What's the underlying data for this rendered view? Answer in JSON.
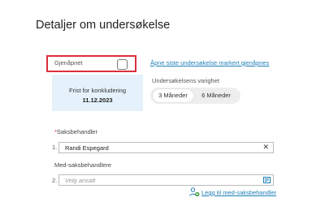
{
  "page": {
    "title": "Detaljer om undersøkelse"
  },
  "reopen": {
    "label": "Gjenåpnet",
    "checked": false,
    "link_text": "Åpne siste undersøkelse markert gjenåpnes"
  },
  "deadline": {
    "label": "Frist for konkludering",
    "date": "11.12.2023"
  },
  "duration": {
    "label": "Undersøkelsens varighet",
    "options": [
      "3 Måneder",
      "6 Måneder"
    ],
    "selected": "3 Måneder"
  },
  "caseworker": {
    "required_mark": "*",
    "label": "Saksbehandler",
    "row_number": "1.",
    "value": "Randi Espegard",
    "clear_icon": "close-icon"
  },
  "co_caseworkers": {
    "label": "Med-saksbehandlere",
    "row_number": "2.",
    "placeholder": "Velg ansatt",
    "picker_icon": "pick-list-icon",
    "add_link": "Legg til med-saksbehandler",
    "add_icon": "add-person-icon"
  },
  "colors": {
    "highlight_border": "#d9303d",
    "link": "#1e7fb8",
    "deadline_bg": "#e5f2fb"
  }
}
